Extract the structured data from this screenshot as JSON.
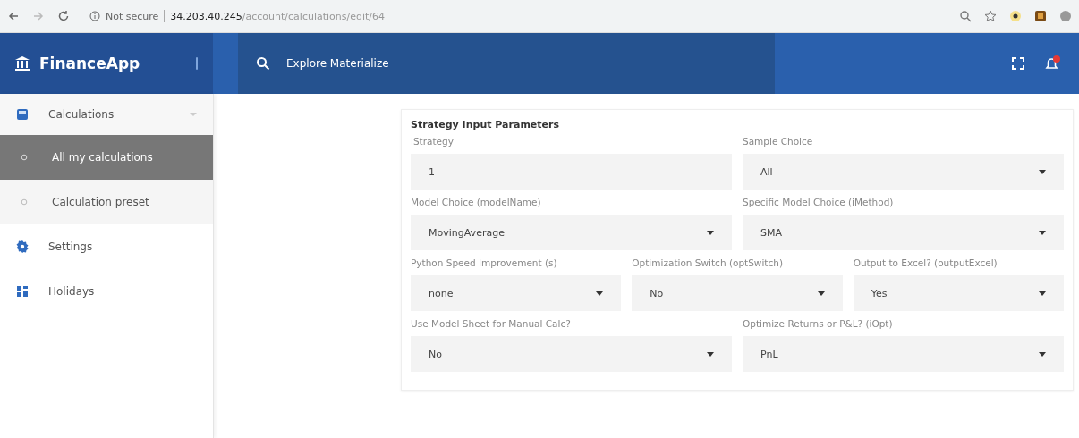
{
  "browser": {
    "security": "Not secure",
    "url_host": "34.203.40.245",
    "url_path": "/account/calculations/edit/64"
  },
  "app": {
    "brand": "FinanceApp",
    "search_placeholder": "Explore Materialize"
  },
  "sidebar": {
    "items": [
      {
        "label": "Calculations",
        "kind": "calc",
        "expanded": true,
        "selected": false,
        "children": [
          {
            "label": "All my calculations",
            "selected": true
          },
          {
            "label": "Calculation preset",
            "selected": false
          }
        ]
      },
      {
        "label": "Settings",
        "kind": "gear",
        "selected": false
      },
      {
        "label": "Holidays",
        "kind": "grid",
        "selected": false
      }
    ]
  },
  "form": {
    "title": "Strategy Input Parameters",
    "rows": [
      [
        {
          "label": "iStrategy",
          "kind": "text",
          "value": "1"
        },
        {
          "label": "Sample Choice",
          "kind": "select",
          "value": "All"
        }
      ],
      [
        {
          "label": "Model Choice (modelName)",
          "kind": "select",
          "value": "MovingAverage"
        },
        {
          "label": "Specific Model Choice (iMethod)",
          "kind": "select",
          "value": "SMA"
        }
      ],
      [
        {
          "label": "Python Speed Improvement (s)",
          "kind": "select",
          "value": "none"
        },
        {
          "label": "Optimization Switch (optSwitch)",
          "kind": "select",
          "value": "No"
        },
        {
          "label": "Output to Excel? (outputExcel)",
          "kind": "select",
          "value": "Yes"
        }
      ],
      [
        {
          "label": "Use Model Sheet for Manual Calc?",
          "kind": "select",
          "value": "No"
        },
        {
          "label": "Optimize Returns or P&L? (iOpt)",
          "kind": "select",
          "value": "PnL"
        }
      ]
    ]
  }
}
